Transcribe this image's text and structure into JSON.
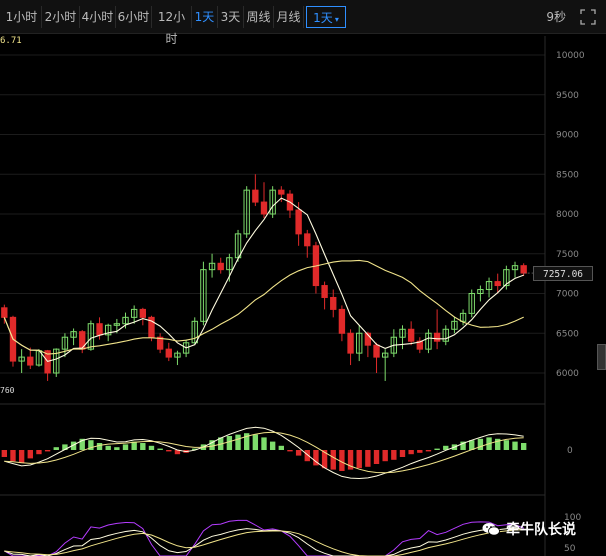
{
  "toolbar": {
    "tabs": [
      "1小时",
      "2小时",
      "4小时",
      "6小时",
      "12小时",
      "1天",
      "3天",
      "周线",
      "月线"
    ],
    "active_tab": "1天",
    "period_select": "1天",
    "refresh_timer": "9秒"
  },
  "price_axis": {
    "ticks": [
      "10000",
      "9500",
      "9000",
      "8500",
      "8000",
      "7500",
      "7000",
      "6500",
      "6000"
    ]
  },
  "current_price": "7257.06",
  "ma_value_fragment": "6.71",
  "low_marker_fragment": "760",
  "macd_axis": {
    "zero": "0"
  },
  "kdj_axis": {
    "ticks": [
      "100",
      "50"
    ]
  },
  "watermark": "牵牛队长说",
  "colors": {
    "up": "#7edc6c",
    "down": "#e02a2a",
    "ma1": "#fffce0",
    "ma2": "#f0e38a",
    "accent": "#2f8fff",
    "kdj_purple": "#b43cff"
  },
  "chart_data": {
    "type": "candlestick",
    "price_range": [
      5800,
      10100
    ],
    "candles": [
      [
        6820,
        6860,
        6620,
        6700
      ],
      [
        6700,
        6720,
        6080,
        6150
      ],
      [
        6150,
        6300,
        6000,
        6200
      ],
      [
        6200,
        6320,
        6050,
        6100
      ],
      [
        6100,
        6300,
        6080,
        6280
      ],
      [
        6280,
        6290,
        5900,
        6000
      ],
      [
        6000,
        6310,
        5950,
        6300
      ],
      [
        6300,
        6500,
        6200,
        6450
      ],
      [
        6450,
        6560,
        6350,
        6520
      ],
      [
        6520,
        6540,
        6250,
        6300
      ],
      [
        6300,
        6660,
        6280,
        6620
      ],
      [
        6620,
        6700,
        6420,
        6480
      ],
      [
        6480,
        6620,
        6400,
        6600
      ],
      [
        6600,
        6680,
        6500,
        6620
      ],
      [
        6620,
        6760,
        6560,
        6700
      ],
      [
        6700,
        6850,
        6620,
        6800
      ],
      [
        6800,
        6820,
        6600,
        6700
      ],
      [
        6700,
        6720,
        6400,
        6450
      ],
      [
        6450,
        6500,
        6250,
        6300
      ],
      [
        6300,
        6380,
        6150,
        6200
      ],
      [
        6200,
        6280,
        6100,
        6250
      ],
      [
        6250,
        6420,
        6200,
        6380
      ],
      [
        6380,
        6700,
        6350,
        6650
      ],
      [
        6650,
        7400,
        6600,
        7300
      ],
      [
        7300,
        7500,
        7200,
        7380
      ],
      [
        7380,
        7450,
        7250,
        7300
      ],
      [
        7300,
        7500,
        7150,
        7450
      ],
      [
        7450,
        7800,
        7400,
        7750
      ],
      [
        7750,
        8350,
        7700,
        8300
      ],
      [
        8300,
        8500,
        8100,
        8150
      ],
      [
        8150,
        8400,
        7950,
        8000
      ],
      [
        8000,
        8350,
        7950,
        8300
      ],
      [
        8300,
        8350,
        8150,
        8250
      ],
      [
        8250,
        8300,
        7950,
        8050
      ],
      [
        8050,
        8150,
        7600,
        7750
      ],
      [
        7750,
        7800,
        7450,
        7600
      ],
      [
        7600,
        7650,
        7000,
        7100
      ],
      [
        7100,
        7150,
        6800,
        6950
      ],
      [
        6950,
        7050,
        6700,
        6800
      ],
      [
        6800,
        6850,
        6400,
        6500
      ],
      [
        6500,
        6550,
        6100,
        6250
      ],
      [
        6250,
        6600,
        6150,
        6500
      ],
      [
        6500,
        6520,
        6200,
        6350
      ],
      [
        6350,
        6380,
        6000,
        6200
      ],
      [
        6200,
        6300,
        5900,
        6250
      ],
      [
        6250,
        6550,
        6200,
        6450
      ],
      [
        6450,
        6600,
        6300,
        6550
      ],
      [
        6550,
        6650,
        6350,
        6400
      ],
      [
        6400,
        6450,
        6250,
        6300
      ],
      [
        6300,
        6550,
        6250,
        6500
      ],
      [
        6500,
        6800,
        6300,
        6400
      ],
      [
        6400,
        6600,
        6350,
        6550
      ],
      [
        6550,
        6700,
        6500,
        6650
      ],
      [
        6650,
        6800,
        6600,
        6750
      ],
      [
        6750,
        7050,
        6700,
        7000
      ],
      [
        7000,
        7100,
        6900,
        7050
      ],
      [
        7050,
        7200,
        6950,
        7150
      ],
      [
        7150,
        7250,
        7000,
        7100
      ],
      [
        7100,
        7350,
        7050,
        7300
      ],
      [
        7300,
        7400,
        7200,
        7350
      ],
      [
        7350,
        7380,
        7220,
        7257.06
      ]
    ],
    "macd_hist": [
      -0.5,
      -0.8,
      -0.9,
      -0.6,
      -0.3,
      -0.1,
      0.2,
      0.4,
      0.6,
      0.8,
      0.7,
      0.5,
      0.3,
      0.2,
      0.4,
      0.6,
      0.5,
      0.3,
      0.1,
      -0.1,
      -0.3,
      -0.2,
      0.1,
      0.4,
      0.7,
      0.9,
      1.0,
      1.1,
      1.2,
      1.1,
      0.9,
      0.6,
      0.3,
      -0.1,
      -0.4,
      -0.8,
      -1.1,
      -1.3,
      -1.4,
      -1.5,
      -1.4,
      -1.3,
      -1.2,
      -1.0,
      -0.8,
      -0.7,
      -0.5,
      -0.3,
      -0.2,
      -0.1,
      0.1,
      0.3,
      0.4,
      0.6,
      0.7,
      0.8,
      0.9,
      0.8,
      0.7,
      0.6,
      0.5
    ],
    "kdj_range": [
      0,
      100
    ]
  }
}
